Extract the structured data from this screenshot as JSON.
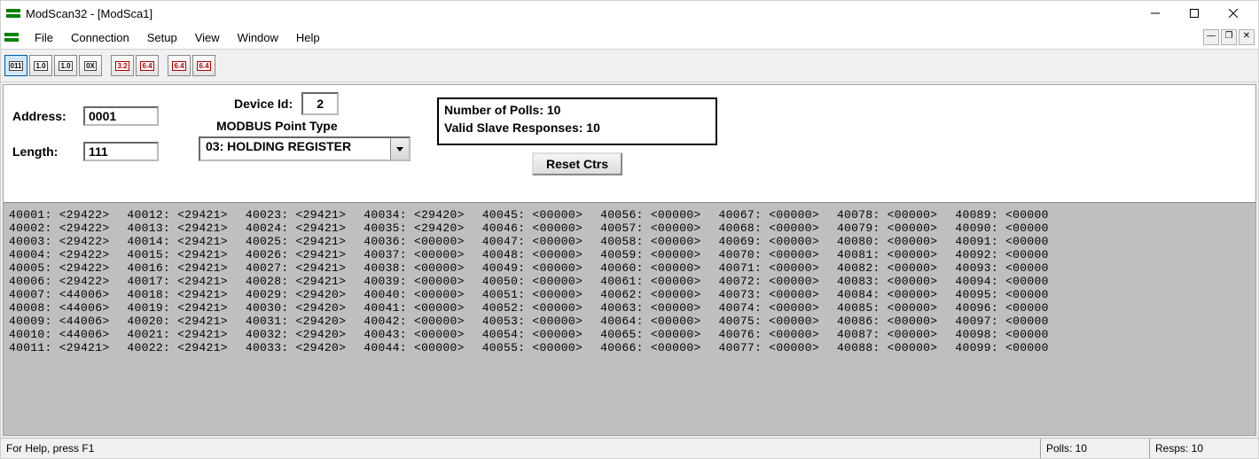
{
  "title": "ModScan32 - [ModSca1]",
  "window_controls": {
    "min": "window-minimize",
    "max": "window-maximize",
    "close": "window-close"
  },
  "menu": {
    "items": [
      "File",
      "Connection",
      "Setup",
      "View",
      "Window",
      "Help"
    ]
  },
  "mdi": {
    "min": "—",
    "restore": "❐",
    "close": "✕"
  },
  "toolbar": {
    "buttons": [
      "011",
      "1.0",
      "1.0",
      "0X",
      "3.2",
      "6.4",
      "6.4",
      "6.4"
    ]
  },
  "form": {
    "address_label": "Address:",
    "address_value": "0001",
    "length_label": "Length:",
    "length_value": "111",
    "device_id_label": "Device Id:",
    "device_id_value": "2",
    "pointtype_label": "MODBUS Point Type",
    "pointtype_value": "03: HOLDING REGISTER",
    "polls_text": "Number of Polls: 10",
    "valid_text": "Valid Slave Responses: 10",
    "reset_label": "Reset Ctrs"
  },
  "statusbar": {
    "hint": "For Help, press F1",
    "polls": "Polls: 10",
    "resps": "Resps: 10"
  },
  "registers": [
    {
      "a": "40001",
      "v": "29422"
    },
    {
      "a": "40002",
      "v": "29422"
    },
    {
      "a": "40003",
      "v": "29422"
    },
    {
      "a": "40004",
      "v": "29422"
    },
    {
      "a": "40005",
      "v": "29422"
    },
    {
      "a": "40006",
      "v": "29422"
    },
    {
      "a": "40007",
      "v": "44006"
    },
    {
      "a": "40008",
      "v": "44006"
    },
    {
      "a": "40009",
      "v": "44006"
    },
    {
      "a": "40010",
      "v": "44006"
    },
    {
      "a": "40011",
      "v": "29421"
    },
    {
      "a": "40012",
      "v": "29421"
    },
    {
      "a": "40013",
      "v": "29421"
    },
    {
      "a": "40014",
      "v": "29421"
    },
    {
      "a": "40015",
      "v": "29421"
    },
    {
      "a": "40016",
      "v": "29421"
    },
    {
      "a": "40017",
      "v": "29421"
    },
    {
      "a": "40018",
      "v": "29421"
    },
    {
      "a": "40019",
      "v": "29421"
    },
    {
      "a": "40020",
      "v": "29421"
    },
    {
      "a": "40021",
      "v": "29421"
    },
    {
      "a": "40022",
      "v": "29421"
    },
    {
      "a": "40023",
      "v": "29421"
    },
    {
      "a": "40024",
      "v": "29421"
    },
    {
      "a": "40025",
      "v": "29421"
    },
    {
      "a": "40026",
      "v": "29421"
    },
    {
      "a": "40027",
      "v": "29421"
    },
    {
      "a": "40028",
      "v": "29421"
    },
    {
      "a": "40029",
      "v": "29420"
    },
    {
      "a": "40030",
      "v": "29420"
    },
    {
      "a": "40031",
      "v": "29420"
    },
    {
      "a": "40032",
      "v": "29420"
    },
    {
      "a": "40033",
      "v": "29420"
    },
    {
      "a": "40034",
      "v": "29420"
    },
    {
      "a": "40035",
      "v": "29420"
    },
    {
      "a": "40036",
      "v": "00000"
    },
    {
      "a": "40037",
      "v": "00000"
    },
    {
      "a": "40038",
      "v": "00000"
    },
    {
      "a": "40039",
      "v": "00000"
    },
    {
      "a": "40040",
      "v": "00000"
    },
    {
      "a": "40041",
      "v": "00000"
    },
    {
      "a": "40042",
      "v": "00000"
    },
    {
      "a": "40043",
      "v": "00000"
    },
    {
      "a": "40044",
      "v": "00000"
    },
    {
      "a": "40045",
      "v": "00000"
    },
    {
      "a": "40046",
      "v": "00000"
    },
    {
      "a": "40047",
      "v": "00000"
    },
    {
      "a": "40048",
      "v": "00000"
    },
    {
      "a": "40049",
      "v": "00000"
    },
    {
      "a": "40050",
      "v": "00000"
    },
    {
      "a": "40051",
      "v": "00000"
    },
    {
      "a": "40052",
      "v": "00000"
    },
    {
      "a": "40053",
      "v": "00000"
    },
    {
      "a": "40054",
      "v": "00000"
    },
    {
      "a": "40055",
      "v": "00000"
    },
    {
      "a": "40056",
      "v": "00000"
    },
    {
      "a": "40057",
      "v": "00000"
    },
    {
      "a": "40058",
      "v": "00000"
    },
    {
      "a": "40059",
      "v": "00000"
    },
    {
      "a": "40060",
      "v": "00000"
    },
    {
      "a": "40061",
      "v": "00000"
    },
    {
      "a": "40062",
      "v": "00000"
    },
    {
      "a": "40063",
      "v": "00000"
    },
    {
      "a": "40064",
      "v": "00000"
    },
    {
      "a": "40065",
      "v": "00000"
    },
    {
      "a": "40066",
      "v": "00000"
    },
    {
      "a": "40067",
      "v": "00000"
    },
    {
      "a": "40068",
      "v": "00000"
    },
    {
      "a": "40069",
      "v": "00000"
    },
    {
      "a": "40070",
      "v": "00000"
    },
    {
      "a": "40071",
      "v": "00000"
    },
    {
      "a": "40072",
      "v": "00000"
    },
    {
      "a": "40073",
      "v": "00000"
    },
    {
      "a": "40074",
      "v": "00000"
    },
    {
      "a": "40075",
      "v": "00000"
    },
    {
      "a": "40076",
      "v": "00000"
    },
    {
      "a": "40077",
      "v": "00000"
    },
    {
      "a": "40078",
      "v": "00000"
    },
    {
      "a": "40079",
      "v": "00000"
    },
    {
      "a": "40080",
      "v": "00000"
    },
    {
      "a": "40081",
      "v": "00000"
    },
    {
      "a": "40082",
      "v": "00000"
    },
    {
      "a": "40083",
      "v": "00000"
    },
    {
      "a": "40084",
      "v": "00000"
    },
    {
      "a": "40085",
      "v": "00000"
    },
    {
      "a": "40086",
      "v": "00000"
    },
    {
      "a": "40087",
      "v": "00000"
    },
    {
      "a": "40088",
      "v": "00000"
    },
    {
      "a": "40089",
      "v": "00000"
    },
    {
      "a": "40090",
      "v": "00000"
    },
    {
      "a": "40091",
      "v": "00000"
    },
    {
      "a": "40092",
      "v": "00000"
    },
    {
      "a": "40093",
      "v": "00000"
    },
    {
      "a": "40094",
      "v": "00000"
    },
    {
      "a": "40095",
      "v": "00000"
    },
    {
      "a": "40096",
      "v": "00000"
    },
    {
      "a": "40097",
      "v": "00000"
    },
    {
      "a": "40098",
      "v": "00000"
    },
    {
      "a": "40099",
      "v": "00000"
    }
  ],
  "grid": {
    "rows": 11,
    "cols": 9
  }
}
